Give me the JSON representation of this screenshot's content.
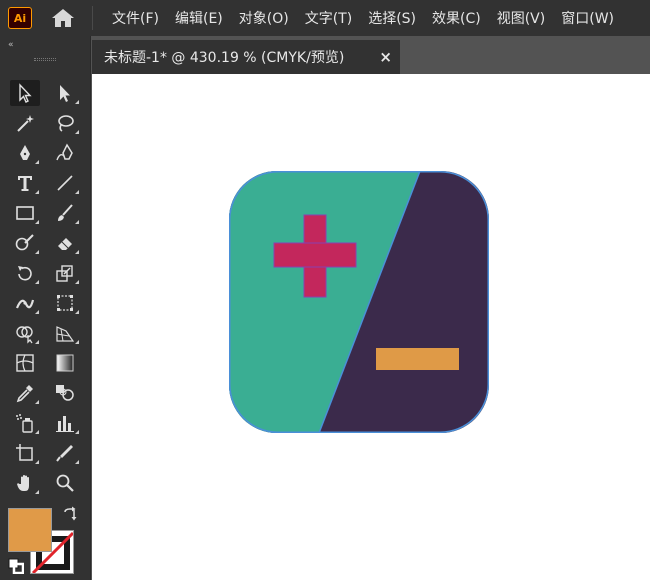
{
  "app": {
    "logo_text": "Ai"
  },
  "menu": {
    "items": [
      "文件(F)",
      "编辑(E)",
      "对象(O)",
      "文字(T)",
      "选择(S)",
      "效果(C)",
      "视图(V)",
      "窗口(W)"
    ]
  },
  "document_tab": {
    "title": "未标题-1* @ 430.19 % (CMYK/预览)",
    "close_label": "×"
  },
  "toolbar": {
    "collapse_label": "«",
    "tools": [
      "selection-tool",
      "direct-selection-tool",
      "magic-wand-tool",
      "lasso-tool",
      "pen-tool",
      "curvature-tool",
      "type-tool",
      "line-segment-tool",
      "rectangle-tool",
      "paintbrush-tool",
      "shaper-tool",
      "eraser-tool",
      "rotate-tool",
      "scale-tool",
      "width-tool",
      "free-transform-tool",
      "shape-builder-tool",
      "perspective-grid-tool",
      "mesh-tool",
      "gradient-tool",
      "eyedropper-tool",
      "blend-tool",
      "symbol-sprayer-tool",
      "column-graph-tool",
      "artboard-tool",
      "slice-tool",
      "hand-tool",
      "zoom-tool"
    ],
    "fill_color": "#e09a48",
    "stroke": "none"
  },
  "artwork": {
    "teal": "#3aae93",
    "purple": "#3b2a4b",
    "plus_color": "#c3275c",
    "minus_color": "#df9a47",
    "outline": "#4a8fd8"
  }
}
